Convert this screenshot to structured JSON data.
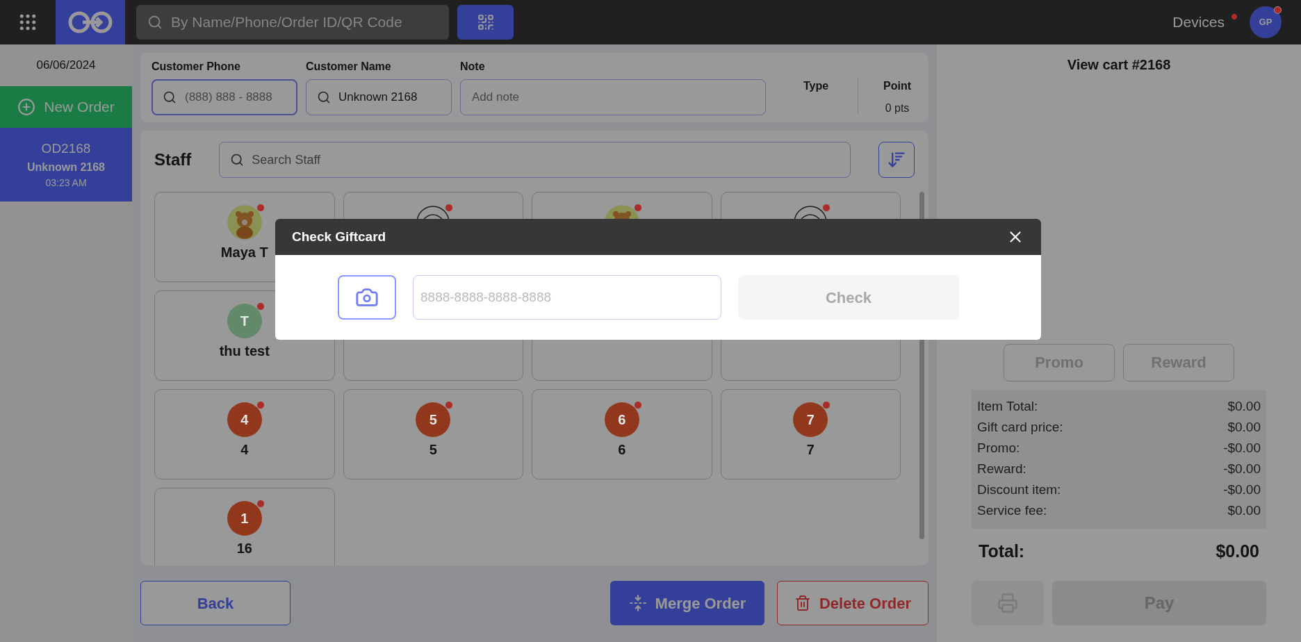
{
  "top_bar": {
    "search": {
      "placeholder": "By Name/Phone/Order ID/QR Code"
    },
    "devices": {
      "label": "Devices",
      "alert": true
    },
    "user": {
      "initials": "GP",
      "alert": true
    }
  },
  "sidebar": {
    "date": "06/06/2024",
    "new_order": "New Order",
    "orders": [
      {
        "id": "OD2168",
        "customer": "Unknown 2168",
        "time": "03:23 AM",
        "selected": true
      }
    ]
  },
  "customer": {
    "fields": [
      {
        "kind": "search",
        "label": "Customer Phone",
        "placeholder": "(888) 888 - 8888",
        "focused": true
      },
      {
        "kind": "search",
        "label": "Customer Name",
        "value": "Unknown 2168",
        "focused": false
      },
      {
        "kind": "plain",
        "label": "Note",
        "placeholder": "Add note",
        "focused": false
      }
    ],
    "type": {
      "label": "Type"
    },
    "point": {
      "label": "Point",
      "value": "0 pts"
    }
  },
  "staff": {
    "title": "Staff",
    "search": {
      "placeholder": "Search Staff"
    },
    "members": [
      {
        "name": "Maya T",
        "alert": true
      },
      {
        "avatar": {
          "kind": "outline"
        },
        "alert": true
      },
      {
        "alert": true
      },
      {
        "avatar": {
          "kind": "outline"
        },
        "alert": true
      },
      {
        "avatar": {
          "kind": "initial",
          "text": "T",
          "color": "#62896a"
        },
        "name": "thu test",
        "alert": true
      },
      {
        "avatar": {
          "kind": "covered"
        }
      },
      {
        "avatar": {
          "kind": "covered"
        }
      },
      {
        "avatar": {
          "kind": "covered"
        }
      },
      {
        "avatar": {
          "kind": "initial",
          "text": "4",
          "color": "#91381c"
        },
        "name": "4",
        "alert": true
      },
      {
        "avatar": {
          "kind": "initial",
          "text": "5",
          "color": "#91381c"
        },
        "name": "5",
        "alert": true
      },
      {
        "avatar": {
          "kind": "initial",
          "text": "6",
          "color": "#91381c"
        },
        "name": "6",
        "alert": true
      },
      {
        "avatar": {
          "kind": "initial",
          "text": "7",
          "color": "#91381c"
        },
        "name": "7",
        "alert": true
      },
      {
        "avatar": {
          "kind": "initial",
          "text": "1",
          "color": "#91381c"
        },
        "name": "16",
        "alert": true
      }
    ]
  },
  "actions": {
    "back": "Back",
    "merge": "Merge Order",
    "delete": "Delete Order"
  },
  "cart": {
    "title": "View cart #2168",
    "discounts": [
      {
        "label": "Promo",
        "disabled": true
      },
      {
        "label": "Reward",
        "disabled": true
      }
    ],
    "summary": [
      {
        "label": "Item Total:",
        "value": "$0.00"
      },
      {
        "label": "Gift card price:",
        "value": "$0.00"
      },
      {
        "label": "Promo:",
        "value": "-$0.00"
      },
      {
        "label": "Reward:",
        "value": "-$0.00"
      },
      {
        "label": "Discount item:",
        "value": "-$0.00"
      },
      {
        "label": "Service fee:",
        "value": "$0.00"
      }
    ],
    "total": {
      "label": "Total:",
      "value": "$0.00"
    },
    "print": {
      "disabled": true
    },
    "pay": {
      "label": "Pay",
      "disabled": true
    }
  },
  "dialog": {
    "title": "Check Giftcard",
    "input": {
      "placeholder": "8888-8888-8888-8888"
    },
    "check": {
      "label": "Check",
      "disabled": true
    }
  }
}
